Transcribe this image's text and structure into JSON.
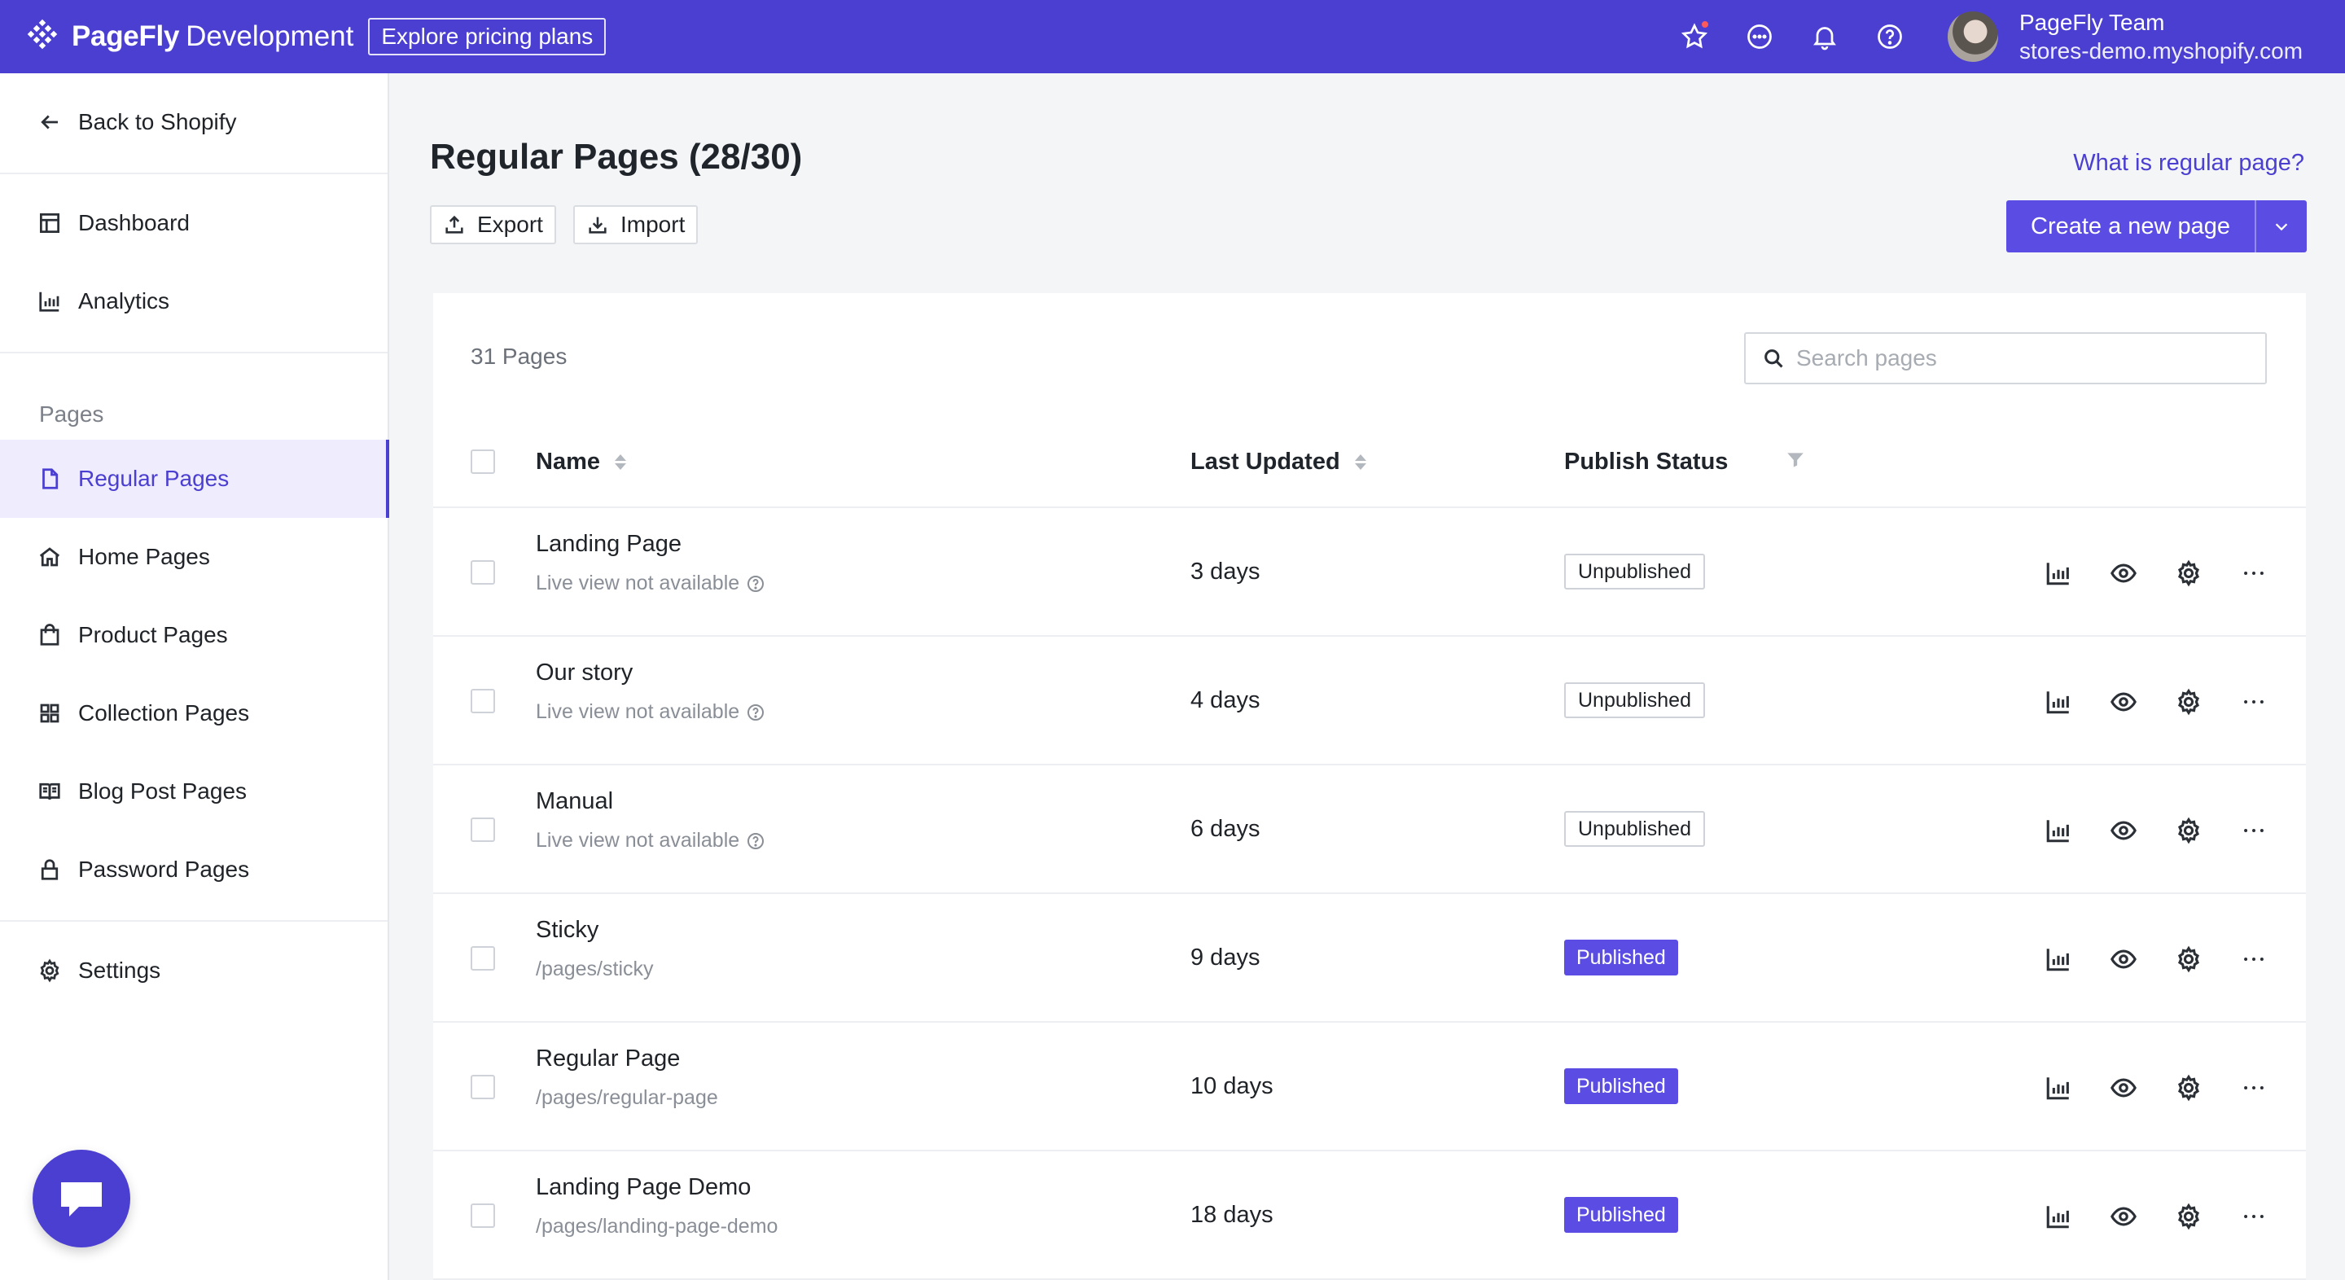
{
  "topbar": {
    "brand": "PageFly",
    "env": "Development",
    "pricing_label": "Explore pricing plans",
    "user_name": "PageFly Team",
    "user_store": "stores-demo.myshopify.com",
    "accent": "#4b3fd1"
  },
  "sidebar": {
    "back_label": "Back to Shopify",
    "dashboard_label": "Dashboard",
    "analytics_label": "Analytics",
    "pages_heading": "Pages",
    "items": [
      {
        "label": "Regular Pages",
        "icon": "page-icon",
        "active": true
      },
      {
        "label": "Home Pages",
        "icon": "home-icon"
      },
      {
        "label": "Product Pages",
        "icon": "bag-icon"
      },
      {
        "label": "Collection Pages",
        "icon": "grid-icon"
      },
      {
        "label": "Blog Post Pages",
        "icon": "book-icon"
      },
      {
        "label": "Password Pages",
        "icon": "lock-icon"
      }
    ],
    "settings_label": "Settings"
  },
  "main": {
    "title": "Regular Pages (28/30)",
    "help_link": "What is regular page?",
    "export_label": "Export",
    "import_label": "Import",
    "create_label": "Create a new page",
    "count_label": "31 Pages",
    "search_placeholder": "Search pages",
    "columns": {
      "name": "Name",
      "updated": "Last Updated",
      "status": "Publish Status"
    },
    "rows": [
      {
        "name": "Landing Page",
        "sub": "Live view not available",
        "updated": "3 days",
        "status": "Unpublished"
      },
      {
        "name": "Our story",
        "sub": "Live view not available",
        "updated": "4 days",
        "status": "Unpublished"
      },
      {
        "name": "Manual",
        "sub": "Live view not available",
        "updated": "6 days",
        "status": "Unpublished"
      },
      {
        "name": "Sticky",
        "sub": "/pages/sticky",
        "updated": "9 days",
        "status": "Published"
      },
      {
        "name": "Regular Page",
        "sub": "/pages/regular-page",
        "updated": "10 days",
        "status": "Published"
      },
      {
        "name": "Landing Page Demo",
        "sub": "/pages/landing-page-demo",
        "updated": "18 days",
        "status": "Published"
      }
    ]
  }
}
